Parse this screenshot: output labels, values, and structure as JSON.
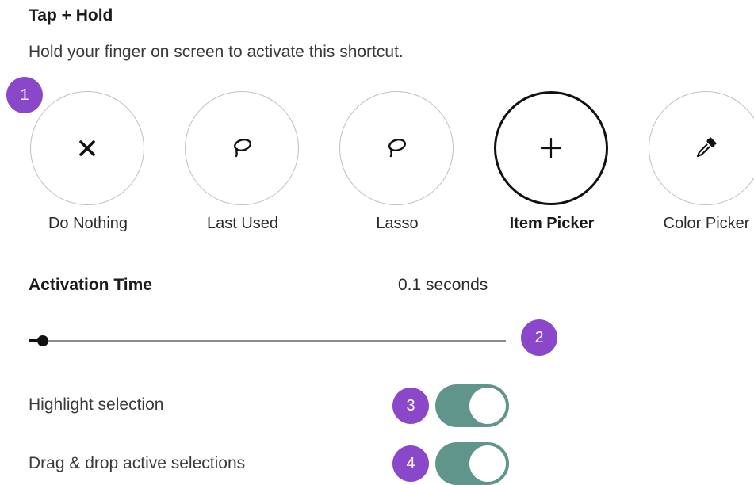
{
  "header": {
    "title": "Tap + Hold",
    "subtitle": "Hold your finger on screen to activate this shortcut."
  },
  "options": [
    {
      "label": "Do Nothing",
      "icon": "close-icon",
      "selected": false
    },
    {
      "label": "Last Used",
      "icon": "lasso-icon",
      "selected": false
    },
    {
      "label": "Lasso",
      "icon": "lasso-icon",
      "selected": false
    },
    {
      "label": "Item Picker",
      "icon": "plus-icon",
      "selected": true
    },
    {
      "label": "Color Picker",
      "icon": "eyedropper-icon",
      "selected": false
    }
  ],
  "activation": {
    "label": "Activation Time",
    "value_text": "0.1 seconds",
    "slider_fraction": 0.03
  },
  "settings": [
    {
      "label": "Highlight selection",
      "enabled": true
    },
    {
      "label": "Drag & drop active selections",
      "enabled": true
    }
  ],
  "badges": [
    "1",
    "2",
    "3",
    "4"
  ],
  "colors": {
    "accent_purple": "#8b47c9",
    "toggle_on": "#5f958b",
    "circle_border": "#b9c2c0"
  }
}
